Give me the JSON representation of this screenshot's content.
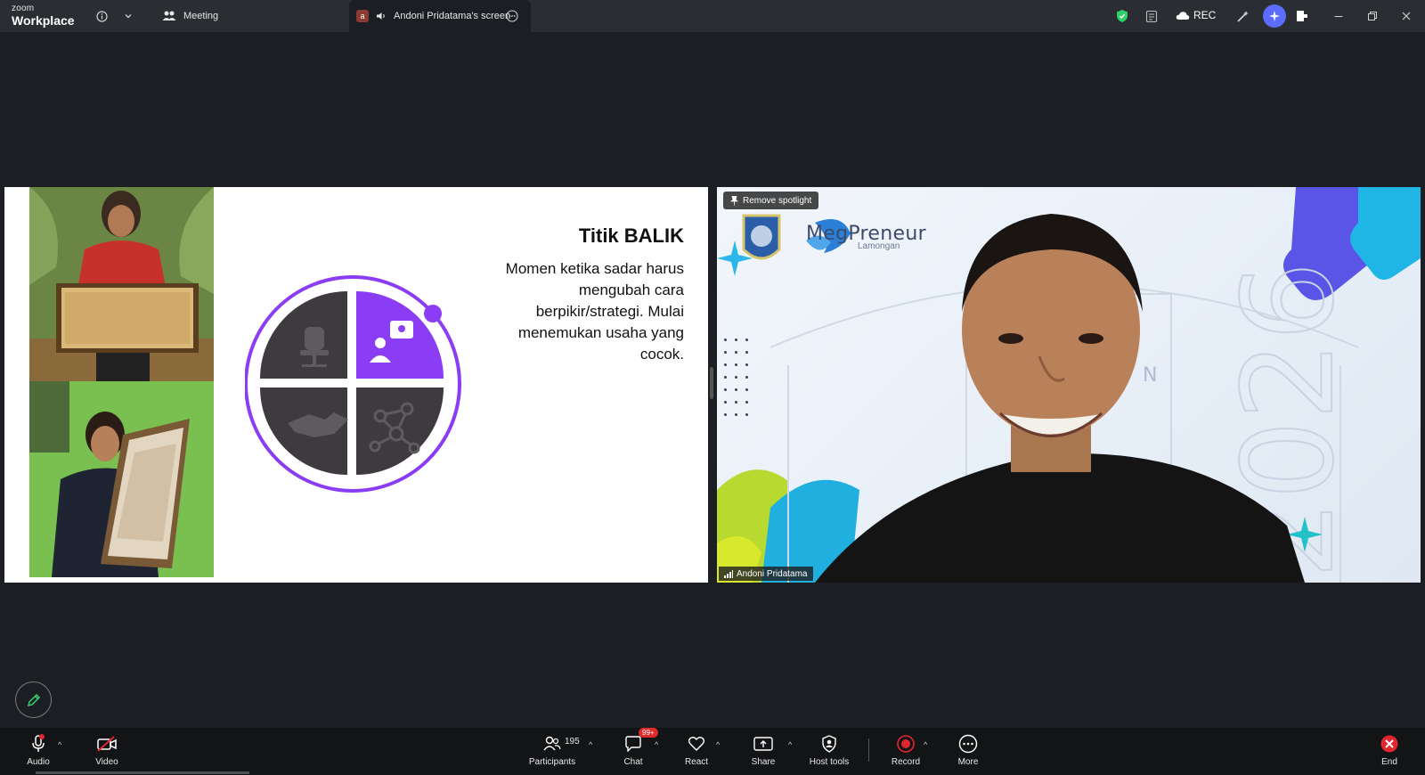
{
  "app": {
    "logo_top": "zoom",
    "logo_bottom": "Workplace"
  },
  "titlebar": {
    "meeting_tab_label": "Meeting",
    "screen_tab_avatar": "a",
    "screen_tab_label": "Andoni Pridatama's screen",
    "rec_label": "REC"
  },
  "slide": {
    "title": "Titik BALIK",
    "body": "Momen ketika sadar harus mengubah cara berpikir/strategi. Mulai menemukan usaha yang cocok."
  },
  "video": {
    "spotlight_button": "Remove spotlight",
    "brand_name": "MegPreneur",
    "brand_sub": "Lamongan",
    "participant_name": "Andoni Pridatama",
    "background_year": "2026",
    "background_letter": "N"
  },
  "toolbar": {
    "audio": "Audio",
    "video": "Video",
    "participants": "Participants",
    "participants_count": "195",
    "chat": "Chat",
    "chat_badge": "99+",
    "react": "React",
    "share": "Share",
    "host_tools": "Host tools",
    "record": "Record",
    "more": "More",
    "end": "End"
  },
  "colors": {
    "accent_purple": "#8b3df5",
    "quadrant_dark": "#3e3a3f",
    "record_red": "#e0262e",
    "shield_green": "#2fcf6a",
    "ai_blue": "#5b6cff"
  }
}
